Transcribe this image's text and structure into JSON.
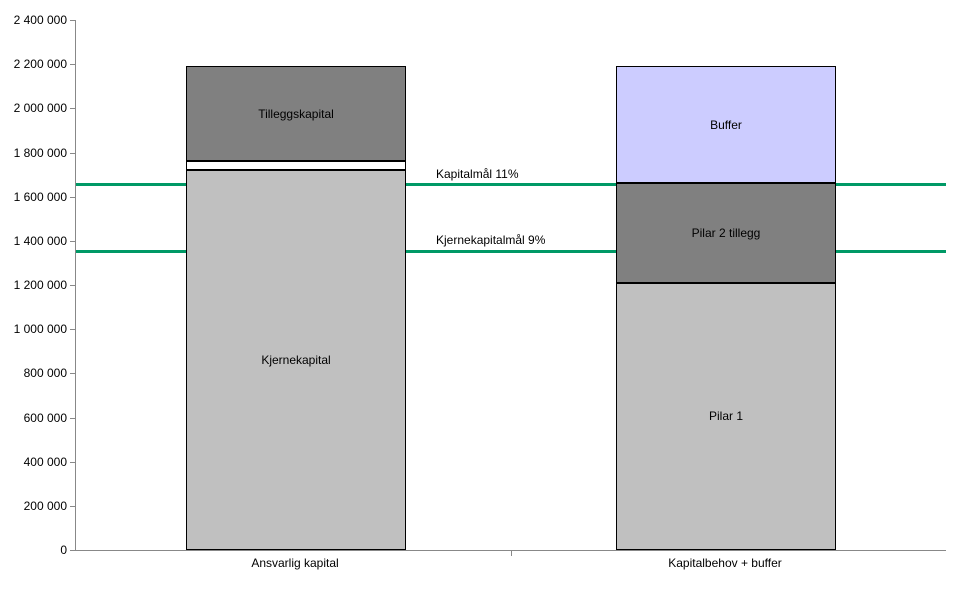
{
  "chart_data": {
    "type": "bar",
    "categories": [
      "Ansvarlig kapital",
      "Kapitalbehov + buffer"
    ],
    "series": [
      {
        "name": "Kjernekapital",
        "category": "Ansvarlig kapital",
        "value": 1720000,
        "color": "light"
      },
      {
        "name": "(gap)",
        "category": "Ansvarlig kapital",
        "value": 40000,
        "color": "white"
      },
      {
        "name": "Tilleggskapital",
        "category": "Ansvarlig kapital",
        "value": 430000,
        "color": "dark"
      },
      {
        "name": "Pilar 1",
        "category": "Kapitalbehov + buffer",
        "value": 1210000,
        "color": "light"
      },
      {
        "name": "Pilar 2 tillegg",
        "category": "Kapitalbehov + buffer",
        "value": 450000,
        "color": "dark"
      },
      {
        "name": "Buffer",
        "category": "Kapitalbehov + buffer",
        "value": 530000,
        "color": "lavender"
      }
    ],
    "ylabel": "",
    "xlabel": "",
    "ylim": [
      0,
      2400000
    ],
    "ystep": 200000,
    "reference_lines": [
      {
        "label": "Kapitalmål 11%",
        "value": 1660000
      },
      {
        "label": "Kjernekapitalmål 9%",
        "value": 1360000
      }
    ],
    "colors": {
      "light": "#c0c0c0",
      "dark": "#808080",
      "lavender": "#ccccff",
      "refline": "#009966"
    }
  },
  "yticks": [
    {
      "label": "0"
    },
    {
      "label": "200 000"
    },
    {
      "label": "400 000"
    },
    {
      "label": "600 000"
    },
    {
      "label": "800 000"
    },
    {
      "label": "1 000 000"
    },
    {
      "label": "1 200 000"
    },
    {
      "label": "1 400 000"
    },
    {
      "label": "1 600 000"
    },
    {
      "label": "1 800 000"
    },
    {
      "label": "2 000 000"
    },
    {
      "label": "2 200 000"
    },
    {
      "label": "2 400 000"
    }
  ],
  "xcats": {
    "cat0": "Ansvarlig kapital",
    "cat1": "Kapitalbehov + buffer"
  },
  "segLabels": {
    "kjerne": "Kjernekapital",
    "tillegg": "Tilleggskapital",
    "pilar1": "Pilar 1",
    "pilar2": "Pilar 2 tillegg",
    "buffer": "Buffer"
  },
  "refLabels": {
    "r11": "Kapitalmål 11%",
    "r9": "Kjernekapitalmål 9%"
  }
}
